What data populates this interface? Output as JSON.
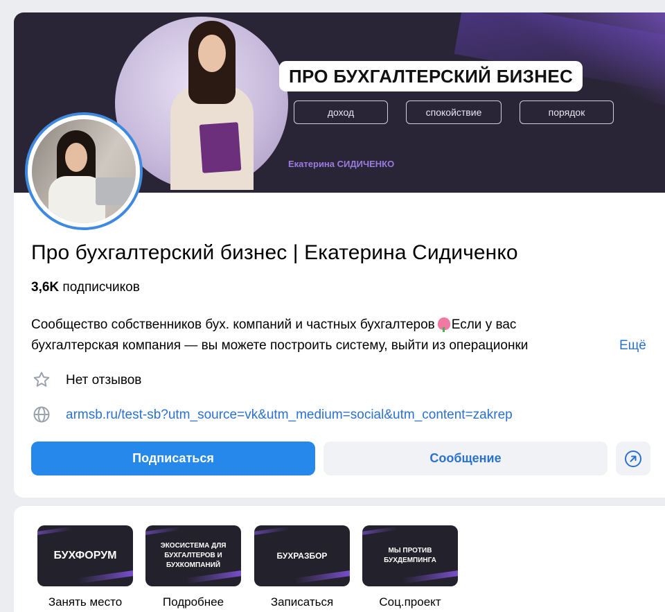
{
  "cover": {
    "headline": "ПРО БУХГАЛТЕРСКИЙ БИЗНЕС",
    "pills": [
      "доход",
      "спокойствие",
      "порядок"
    ],
    "signature": "Екатерина СИДИЧЕНКО"
  },
  "profile": {
    "title": "Про бухгалтерский бизнес | Екатерина Сидиченко",
    "subscribers_count": "3,6K",
    "subscribers_label": "подписчиков",
    "description_line1_a": "Сообщество собственников бух. компаний и частных бухгалтеров",
    "description_line1_b": "Если у вас",
    "description_line2": "бухгалтерская компания — вы можете построить систему, выйти из операционки",
    "more_link": "Ещё",
    "reviews": "Нет отзывов",
    "website": "armsb.ru/test-sb?utm_source=vk&utm_medium=social&utm_content=zakrep"
  },
  "actions": {
    "subscribe": "Подписаться",
    "message": "Сообщение"
  },
  "links": [
    {
      "tile": "БУХФОРУМ",
      "label": "Занять место"
    },
    {
      "tile": "ЭКОСИСТЕМА ДЛЯ БУХГАЛТЕРОВ И БУХКОМПАНИЙ",
      "label": "Подробнее"
    },
    {
      "tile": "БУХРАЗБОР",
      "label": "Записаться"
    },
    {
      "tile": "МЫ ПРОТИВ БУХДЕМПИНГА",
      "label": "Соц.проект"
    }
  ],
  "colors": {
    "primary": "#2688eb",
    "link": "#2a71d0",
    "cover_bg": "#2a2536",
    "accent_purple": "#8a5ce6"
  },
  "icons": {
    "reviews": "star-icon",
    "website": "globe-icon",
    "share": "share-arrow-icon"
  }
}
